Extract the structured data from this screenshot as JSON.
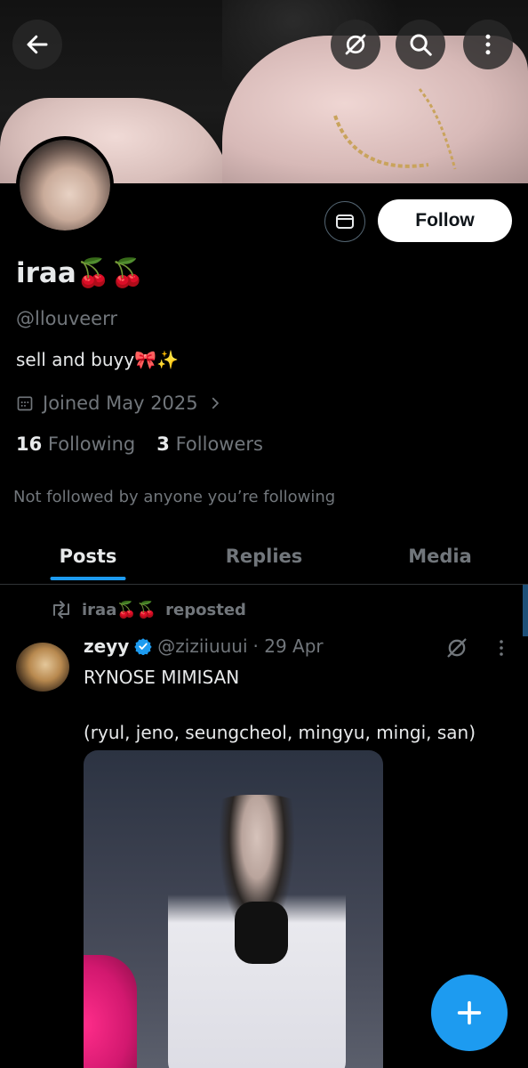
{
  "header": {
    "back_label": "Back",
    "grok_label": "Grok",
    "search_label": "Search",
    "more_label": "More"
  },
  "profile": {
    "display_name": "iraa🍒🍒",
    "handle": "@llouveerr",
    "bio": "sell and buyy🎀✨",
    "joined": "Joined May 2025",
    "following_count": "16",
    "following_label": "Following",
    "followers_count": "3",
    "followers_label": "Followers",
    "not_followed": "Not followed by anyone you’re following",
    "follow_label": "Follow"
  },
  "tabs": [
    {
      "label": "Posts",
      "active": true
    },
    {
      "label": "Replies",
      "active": false
    },
    {
      "label": "Media",
      "active": false
    }
  ],
  "post": {
    "repost_by": "iraa🍒🍒",
    "repost_label": "reposted",
    "author_name": "zeyy",
    "author_handle": "@ziziiuuui",
    "date": "· 29 Apr",
    "text": "RYNOSE MIMISAN\n\n(ryul, jeno, seungcheol, mingyu, mingi, san)"
  },
  "colors": {
    "accent": "#1d9bf0",
    "background": "#000000",
    "secondary_text": "#71767b",
    "primary_text": "#e7e9ea"
  },
  "icons": [
    "back-arrow-icon",
    "grok-icon",
    "search-icon",
    "more-vertical-icon",
    "mail-icon",
    "calendar-icon",
    "chevron-right-icon",
    "repost-icon",
    "verified-badge-icon",
    "plus-icon"
  ]
}
